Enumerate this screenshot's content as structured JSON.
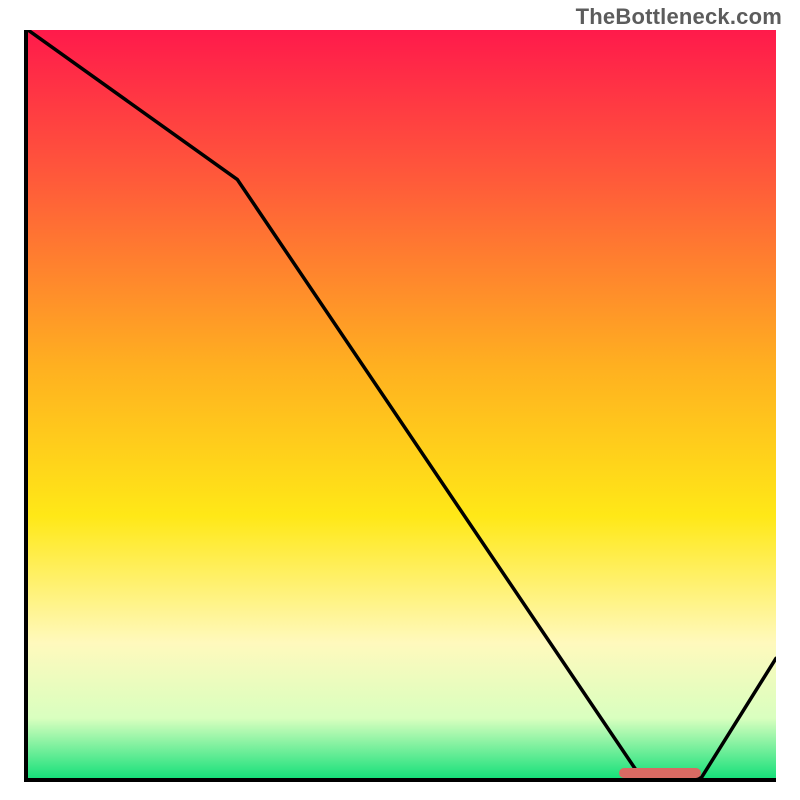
{
  "watermark": "TheBottleneck.com",
  "chart_data": {
    "type": "line",
    "title": "",
    "xlabel": "",
    "ylabel": "",
    "xlim": [
      0,
      100
    ],
    "ylim": [
      0,
      100
    ],
    "grid": false,
    "series": [
      {
        "name": "curve",
        "x": [
          0,
          28,
          82,
          90,
          100
        ],
        "values": [
          100,
          80,
          0,
          0,
          16
        ]
      }
    ],
    "annotations": [
      {
        "name": "optimal-range-marker",
        "x_start": 79,
        "x_end": 90,
        "y": 0.5,
        "color": "#d96a63"
      }
    ],
    "gradient_stops": [
      {
        "offset": 0.0,
        "color": "#ff1a4b"
      },
      {
        "offset": 0.2,
        "color": "#ff5a3a"
      },
      {
        "offset": 0.45,
        "color": "#ffb020"
      },
      {
        "offset": 0.65,
        "color": "#ffe817"
      },
      {
        "offset": 0.82,
        "color": "#fff9bd"
      },
      {
        "offset": 0.92,
        "color": "#d9ffbf"
      },
      {
        "offset": 1.0,
        "color": "#17e07a"
      }
    ]
  }
}
